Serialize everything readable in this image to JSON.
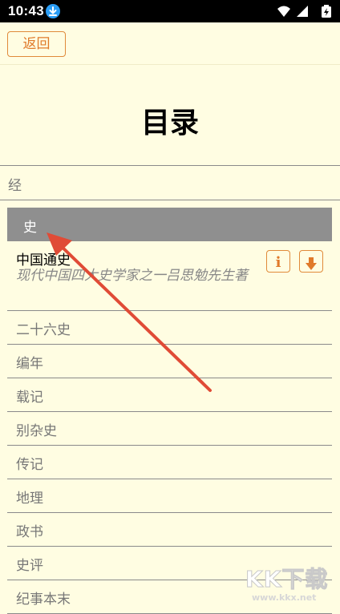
{
  "status_bar": {
    "time": "10:43",
    "icons": [
      "download-icon",
      "wifi-icon",
      "signal-icon",
      "battery-icon"
    ]
  },
  "toolbar": {
    "back_label": "返回"
  },
  "page": {
    "title": "目录"
  },
  "sections": {
    "jing": {
      "label": "经"
    },
    "shi": {
      "label": "史"
    }
  },
  "shi_books": [
    {
      "label": "中国通史",
      "description": "现代中国四大史学家之一吕思勉先生著",
      "info_label": "i"
    },
    {
      "label": "二十六史"
    },
    {
      "label": "编年"
    },
    {
      "label": "载记"
    },
    {
      "label": "别杂史"
    },
    {
      "label": "传记"
    },
    {
      "label": "地理"
    },
    {
      "label": "政书"
    },
    {
      "label": "史评"
    },
    {
      "label": "纪事本末"
    }
  ],
  "watermark": {
    "logo": "KK下载",
    "url": "www.kkx.net"
  },
  "colors": {
    "background": "#fffde2",
    "accent": "#e07a2a",
    "selected_header": "#8f8f8f",
    "annotation_arrow": "#e04b36"
  }
}
